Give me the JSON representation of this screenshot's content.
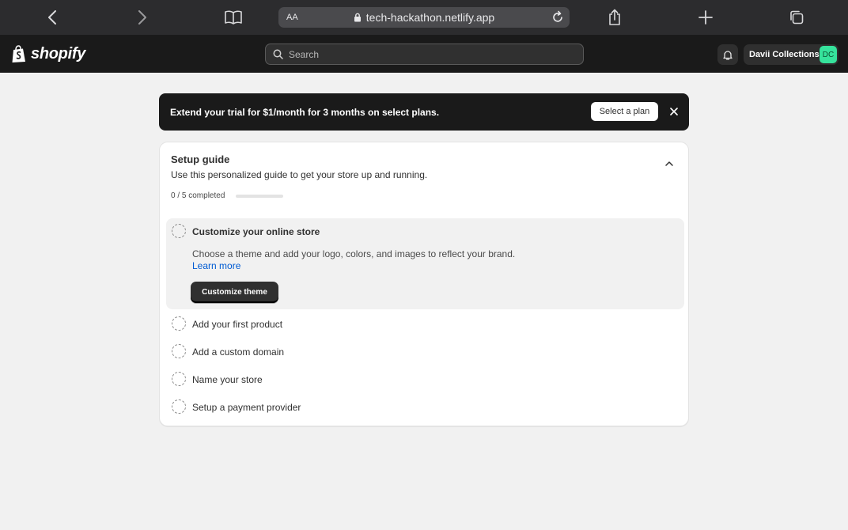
{
  "browser": {
    "aa_label": "AA",
    "url": "tech-hackathon.netlify.app"
  },
  "header": {
    "brand": "shopify",
    "search_placeholder": "Search",
    "store_name": "Davii Collections",
    "avatar_initials": "DC"
  },
  "banner": {
    "text": "Extend your trial for $1/month for 3 months on select plans.",
    "button_label": "Select a plan"
  },
  "setup_guide": {
    "title": "Setup guide",
    "subtitle": "Use this personalized guide to get your store up and running.",
    "progress_text": "0 / 5 completed",
    "progress_fraction": 0,
    "active_step": {
      "title": "Customize your online store",
      "description": "Choose a theme and add your logo, colors, and images to reflect your brand.",
      "link_label": "Learn more",
      "button_label": "Customize theme"
    },
    "steps": [
      {
        "label": "Add your first product"
      },
      {
        "label": "Add a custom domain"
      },
      {
        "label": "Name your store"
      },
      {
        "label": "Setup a payment provider"
      }
    ]
  },
  "colors": {
    "accent_link": "#005bd3",
    "avatar_bg": "#36e39c",
    "topbar_bg": "#1a1a1a"
  }
}
